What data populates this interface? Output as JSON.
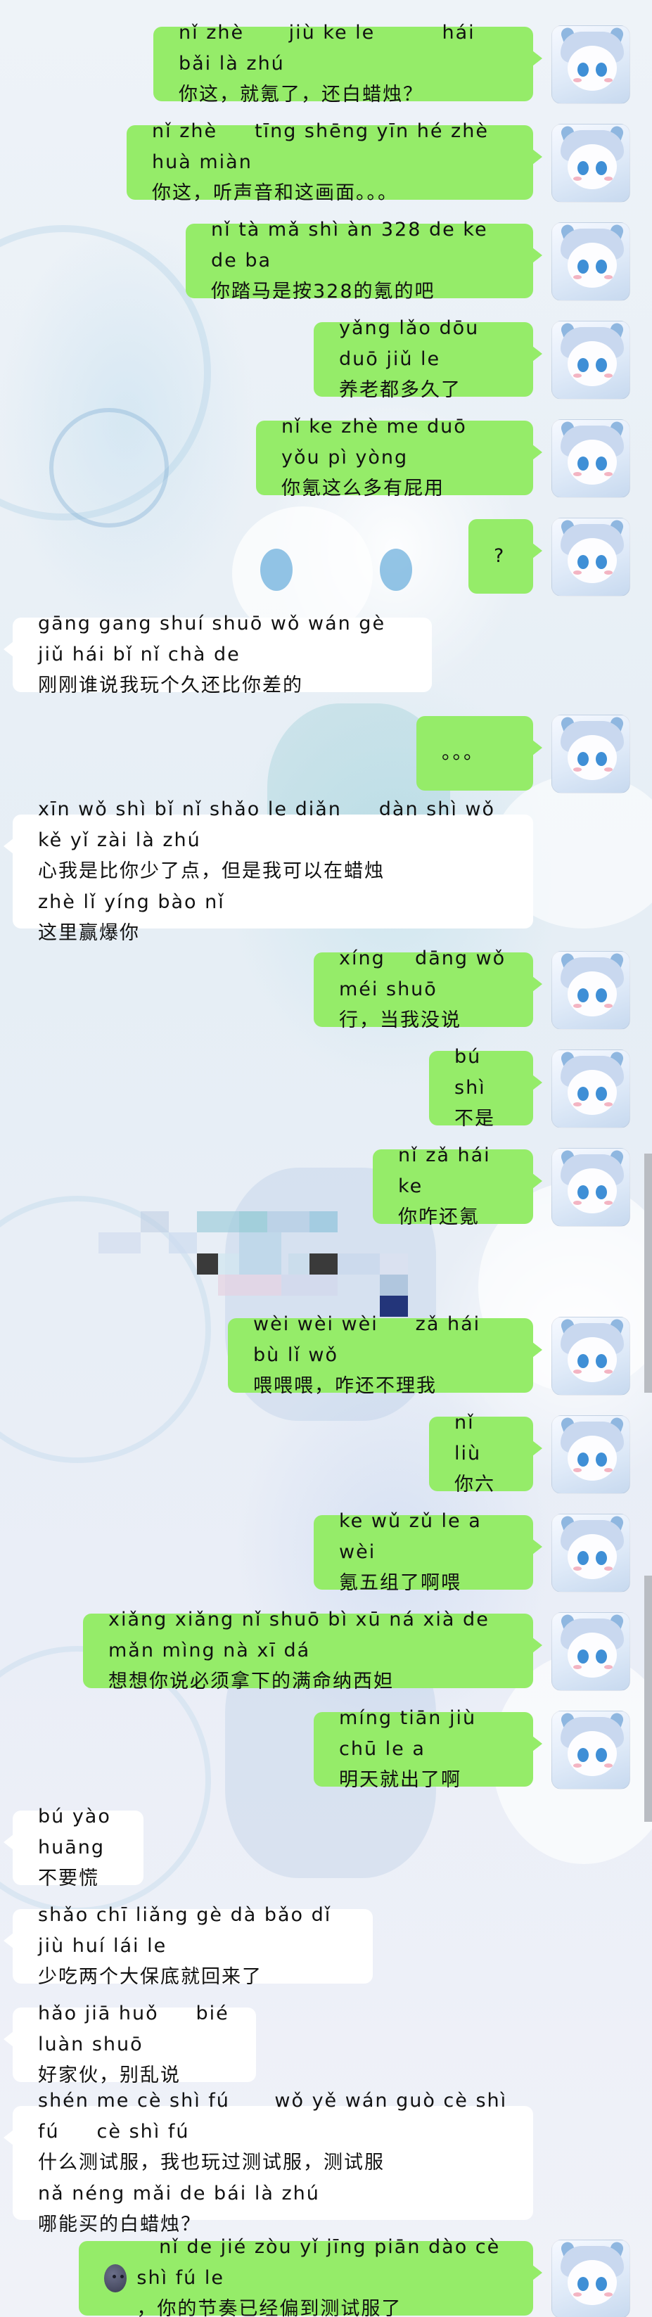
{
  "colors": {
    "outgoing_bubble": "#95ec69",
    "incoming_bubble": "#ffffff"
  },
  "icons": {
    "avatar": "anime-avatar-icon",
    "emoji": "dark-face-emoji-icon"
  },
  "messages": [
    {
      "side": "right",
      "text": "nǐ zhè      jiù ke le         hái bǎi là zhú\n你这，就氪了，还白蜡烛？"
    },
    {
      "side": "right",
      "text": "nǐ zhè     tīng shēng yīn hé zhè huà miàn\n你这，听声音和这画面。。。"
    },
    {
      "side": "right",
      "text": "nǐ tà mǎ shì àn 328 de ke de ba\n你踏马是按328的氪的吧"
    },
    {
      "side": "right",
      "text": "yǎng lǎo dōu duō jiǔ le\n养老都多久了"
    },
    {
      "side": "right",
      "text": "nǐ ke zhè me duō yǒu pì yòng\n你氪这么多有屁用"
    },
    {
      "side": "right",
      "text": "?"
    },
    {
      "side": "left",
      "text": "gāng gang shuí shuō wǒ wán gè jiǔ hái bǐ nǐ chà de\n刚刚谁说我玩个久还比你差的"
    },
    {
      "side": "right",
      "text": "。。。"
    },
    {
      "side": "left",
      "text": "xīn wǒ shì bǐ nǐ shǎo le diǎn     dàn shì wǒ kě yǐ zài là zhú\n心我是比你少了点，但是我可以在蜡烛\nzhè lǐ yíng bào nǐ\n这里赢爆你"
    },
    {
      "side": "right",
      "text": "xíng    dāng wǒ méi shuō\n行，当我没说"
    },
    {
      "side": "right",
      "text": "bú shì\n不是"
    },
    {
      "side": "right",
      "text": "nǐ zǎ hái ke\n你咋还氪"
    },
    {
      "side": "right",
      "text": "wèi wèi wèi     zǎ hái bù lǐ wǒ\n喂喂喂，咋还不理我"
    },
    {
      "side": "right",
      "text": "nǐ liù\n你六"
    },
    {
      "side": "right",
      "text": "ke wǔ zǔ le a wèi\n氪五组了啊喂"
    },
    {
      "side": "right",
      "text": "xiǎng xiǎng nǐ shuō bì xū ná xià de mǎn mìng nà xī dá\n想想你说必须拿下的满命纳西妲"
    },
    {
      "side": "right",
      "text": "míng tiān jiù chū le a\n明天就出了啊"
    },
    {
      "side": "left",
      "text": "bú yào huāng\n不要慌"
    },
    {
      "side": "left",
      "text": "shǎo chī liǎng gè dà bǎo dǐ jiù huí lái le\n少吃两个大保底就回来了"
    },
    {
      "side": "left",
      "text": "hǎo jiā huǒ     bié luàn shuō\n好家伙，别乱说"
    },
    {
      "side": "left",
      "text": "shén me cè shì fú      wǒ yě wán guò cè shì fú     cè shì fú\n什么测试服，我也玩过测试服，测试服\nnǎ néng mǎi de bái là zhú\n哪能买的白蜡烛？"
    },
    {
      "side": "right",
      "emoji": true,
      "text": "   nǐ de jié zòu yǐ jīng piān dào cè shì fú le\n，你的节奏已经偏到测试服了"
    }
  ]
}
